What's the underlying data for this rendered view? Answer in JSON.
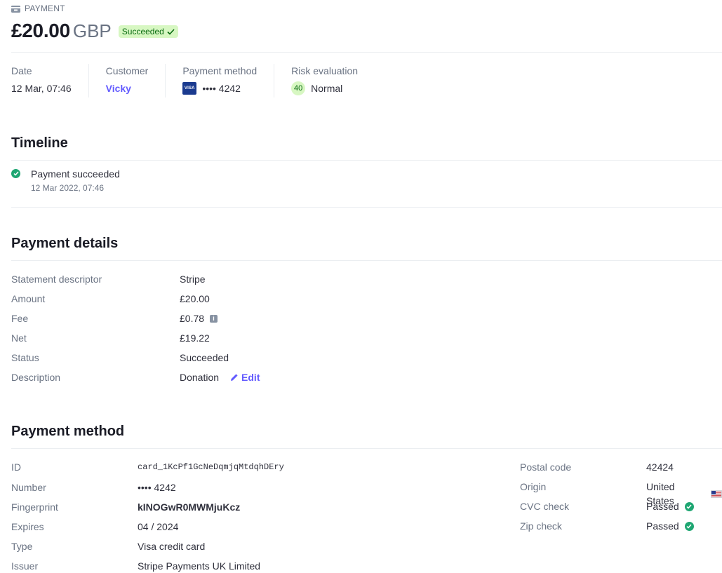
{
  "header": {
    "kicker": "PAYMENT",
    "amount": "£20.00",
    "currency": "GBP",
    "status_badge": "Succeeded"
  },
  "summary": {
    "date_label": "Date",
    "date_value": "12 Mar, 07:46",
    "customer_label": "Customer",
    "customer_value": "Vicky",
    "method_label": "Payment method",
    "method_card_brand": "VISA",
    "method_value": "•••• 4242",
    "risk_label": "Risk evaluation",
    "risk_score": "40",
    "risk_value": "Normal"
  },
  "timeline": {
    "title": "Timeline",
    "items": [
      {
        "title": "Payment succeeded",
        "time": "12 Mar 2022, 07:46"
      }
    ]
  },
  "details": {
    "title": "Payment details",
    "rows": [
      {
        "label": "Statement descriptor",
        "value": "Stripe"
      },
      {
        "label": "Amount",
        "value": "£20.00"
      },
      {
        "label": "Fee",
        "value": "£0.78"
      },
      {
        "label": "Net",
        "value": "£19.22"
      },
      {
        "label": "Status",
        "value": "Succeeded"
      },
      {
        "label": "Description",
        "value": "Donation"
      }
    ],
    "edit_label": "Edit"
  },
  "method": {
    "title": "Payment method",
    "left_rows": [
      {
        "label": "ID",
        "value": "card_1KcPf1GcNeDqmjqMtdqhDEry"
      },
      {
        "label": "Number",
        "value": "•••• 4242"
      },
      {
        "label": "Fingerprint",
        "value": "kINOGwR0MWMjuKcz"
      },
      {
        "label": "Expires",
        "value": "04 / 2024"
      },
      {
        "label": "Type",
        "value": "Visa credit card"
      },
      {
        "label": "Issuer",
        "value": "Stripe Payments UK Limited"
      }
    ],
    "right_rows": [
      {
        "label": "Postal code",
        "value": "42424"
      },
      {
        "label": "Origin",
        "value": "United States"
      },
      {
        "label": "CVC check",
        "value": "Passed"
      },
      {
        "label": "Zip check",
        "value": "Passed"
      }
    ]
  },
  "colors": {
    "accent": "#635bff",
    "success": "#1ea672",
    "badge_bg": "#d7f7c2"
  }
}
